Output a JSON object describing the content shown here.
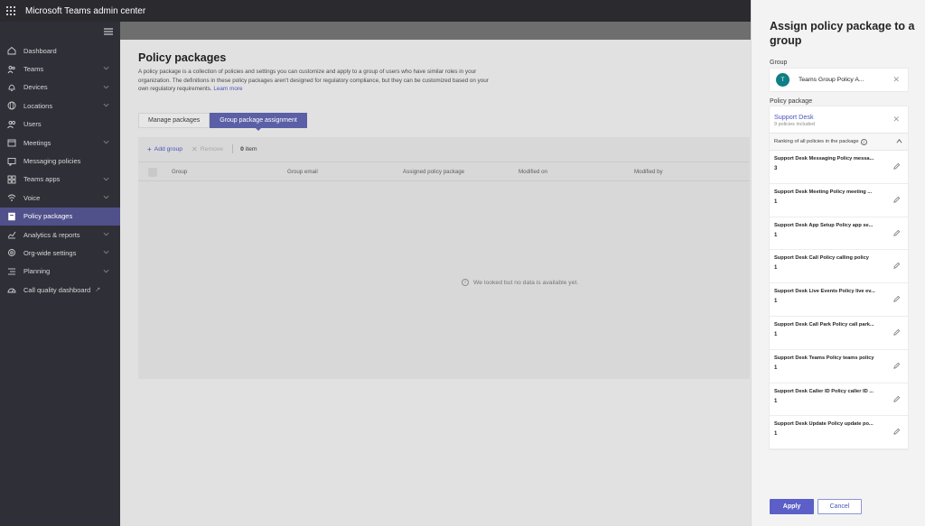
{
  "app": {
    "title": "Microsoft Teams admin center"
  },
  "nav": {
    "items": [
      {
        "label": "Dashboard",
        "icon": "home-icon",
        "chevron": false,
        "active": false
      },
      {
        "label": "Teams",
        "icon": "teams-icon",
        "chevron": true,
        "active": false
      },
      {
        "label": "Devices",
        "icon": "bell-icon",
        "chevron": true,
        "active": false
      },
      {
        "label": "Locations",
        "icon": "globe-icon",
        "chevron": true,
        "active": false
      },
      {
        "label": "Users",
        "icon": "users-icon",
        "chevron": false,
        "active": false
      },
      {
        "label": "Meetings",
        "icon": "calendar-icon",
        "chevron": true,
        "active": false
      },
      {
        "label": "Messaging policies",
        "icon": "message-icon",
        "chevron": false,
        "active": false
      },
      {
        "label": "Teams apps",
        "icon": "apps-icon",
        "chevron": true,
        "active": false
      },
      {
        "label": "Voice",
        "icon": "voice-icon",
        "chevron": true,
        "active": false
      },
      {
        "label": "Policy packages",
        "icon": "package-icon",
        "chevron": false,
        "active": true
      },
      {
        "label": "Analytics & reports",
        "icon": "analytics-icon",
        "chevron": true,
        "active": false
      },
      {
        "label": "Org-wide settings",
        "icon": "gear-icon",
        "chevron": true,
        "active": false
      },
      {
        "label": "Planning",
        "icon": "planning-icon",
        "chevron": true,
        "active": false
      },
      {
        "label": "Call quality dashboard",
        "icon": "dashboard-icon",
        "chevron": false,
        "active": false,
        "external": true
      }
    ]
  },
  "main": {
    "title": "Policy packages",
    "description": "A policy package is a collection of policies and settings you can customize and apply to a group of users who have similar roles in your organization. The definitions in these policy packages aren't designed for regulatory compliance, but they can be customized based on your own regulatory requirements.",
    "learn_more": "Learn more",
    "tabs": [
      {
        "label": "Manage packages",
        "active": false
      },
      {
        "label": "Group package assignment",
        "active": true
      }
    ],
    "toolbar": {
      "add": "Add group",
      "remove": "Remove",
      "count": "0",
      "count_label": "item"
    },
    "columns": [
      "Group",
      "Group email",
      "Assigned policy package",
      "Modified on",
      "Modified by"
    ],
    "empty_text": "We looked but no data is available yet."
  },
  "panel": {
    "title": "Assign policy package to a group",
    "group_label": "Group",
    "group": {
      "initial": "T",
      "name": "Teams Group Policy A...",
      "avatar_color": "#0f7f86"
    },
    "package_label": "Policy package",
    "package": {
      "name": "Support Desk",
      "sub": "9 policies included"
    },
    "ranking_label": "Ranking of all policies in the package",
    "policies": [
      {
        "name": "Support Desk Messaging Policy messa...",
        "rank": "3"
      },
      {
        "name": "Support Desk Meeting Policy meeting ...",
        "rank": "1"
      },
      {
        "name": "Support Desk App Setup Policy app se...",
        "rank": "1"
      },
      {
        "name": "Support Desk Call Policy calling policy",
        "rank": "1"
      },
      {
        "name": "Support Desk Live Events Policy live ev...",
        "rank": "1"
      },
      {
        "name": "Support Desk Call Park Policy call park...",
        "rank": "1"
      },
      {
        "name": "Support Desk Teams Policy teams policy",
        "rank": "1"
      },
      {
        "name": "Support Desk Caller ID Policy caller ID ...",
        "rank": "1"
      },
      {
        "name": "Support Desk Update Policy update po...",
        "rank": "1"
      }
    ],
    "apply": "Apply",
    "cancel": "Cancel"
  },
  "colors": {
    "accent": "#5b5fc7",
    "sidebar": "#2f2f38",
    "topbar": "#2b2b2f"
  }
}
